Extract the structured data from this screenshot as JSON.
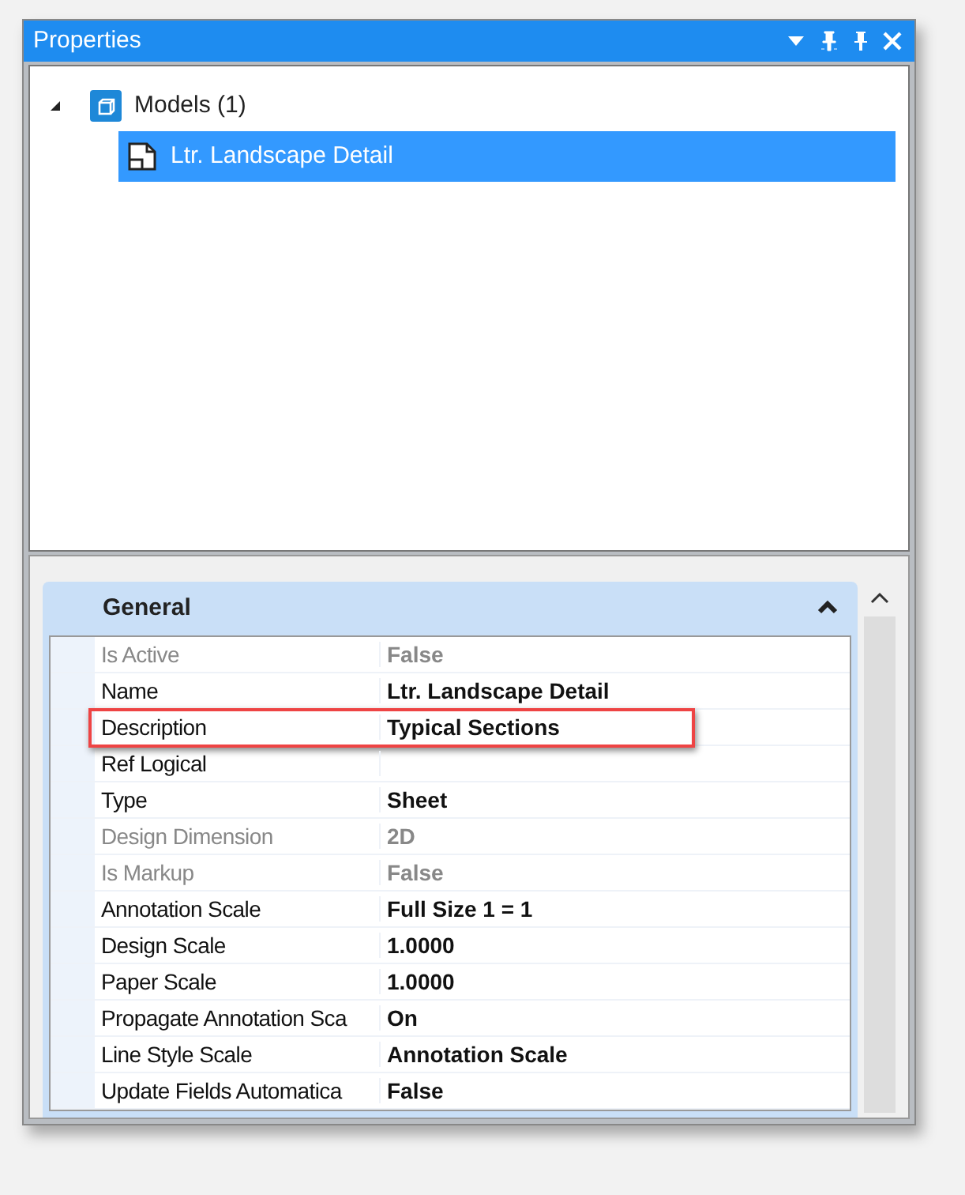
{
  "panel": {
    "title": "Properties"
  },
  "tree": [
    {
      "label": "Models (1)",
      "expanded": true,
      "selected": false,
      "children": [
        {
          "label": "Ltr. Landscape Detail",
          "selected": true
        }
      ]
    }
  ],
  "group": {
    "title": "General",
    "expanded": true
  },
  "properties": [
    {
      "label": "Is Active",
      "value": "False",
      "disabled": true,
      "highlighted": false
    },
    {
      "label": "Name",
      "value": "Ltr. Landscape Detail",
      "disabled": false,
      "highlighted": false
    },
    {
      "label": "Description",
      "value": "Typical Sections",
      "disabled": false,
      "highlighted": true
    },
    {
      "label": "Ref Logical",
      "disabled": false,
      "highlighted": false
    },
    {
      "label": "Type",
      "value": "Sheet",
      "disabled": false,
      "highlighted": false
    },
    {
      "label": "Design Dimension",
      "value": "2D",
      "disabled": true,
      "highlighted": false
    },
    {
      "label": "Is Markup",
      "value": "False",
      "disabled": true,
      "highlighted": false
    },
    {
      "label": "Annotation Scale",
      "value": "Full Size 1 = 1",
      "disabled": false,
      "highlighted": false
    },
    {
      "label": "Design Scale",
      "value": "1.0000",
      "disabled": false,
      "highlighted": false
    },
    {
      "label": "Paper Scale",
      "value": "1.0000",
      "disabled": false,
      "highlighted": false
    },
    {
      "label": "Propagate Annotation Sca",
      "value": "On",
      "disabled": false,
      "highlighted": false
    },
    {
      "label": "Line Style Scale",
      "value": "Annotation Scale",
      "disabled": false,
      "highlighted": false
    },
    {
      "label": "Update Fields Automatica",
      "value": "False",
      "disabled": false,
      "highlighted": false
    }
  ]
}
